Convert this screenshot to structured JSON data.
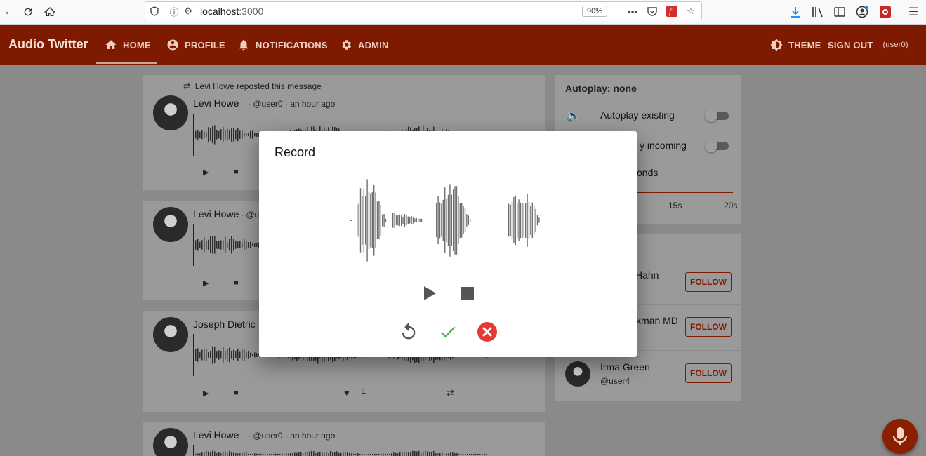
{
  "browser": {
    "url_host": "localhost",
    "url_port": ":3000",
    "zoom": "90%"
  },
  "appbar": {
    "brand": "Audio Twitter",
    "nav": [
      "HOME",
      "PROFILE",
      "NOTIFICATIONS",
      "ADMIN"
    ],
    "theme_label": "THEME",
    "signout_label": "SIGN OUT",
    "signout_user": "(user0)"
  },
  "feed": {
    "posts": [
      {
        "repost_text": "Levi Howe reposted this message",
        "name": "Levi Howe",
        "handle": "@user0",
        "time": "an hour ago"
      },
      {
        "name": "Levi Howe",
        "handle": "@u"
      },
      {
        "name": "Joseph Dietric",
        "likes": "1"
      },
      {
        "name": "Levi Howe",
        "handle": "@user0",
        "time": "an hour ago"
      }
    ]
  },
  "sidebar": {
    "autoplay_title": "Autoplay: none",
    "autoplay_existing": "Autoplay existing",
    "autoplay_incoming_partial": "y incoming",
    "seconds_partial": "onds",
    "tick_15": "15s",
    "tick_20": "20s",
    "follow_users": [
      {
        "name_partial": "Hahn",
        "follow": "FOLLOW"
      },
      {
        "name_partial": "kman MD",
        "follow": "FOLLOW"
      },
      {
        "name": "Irma Green",
        "handle": "@user4",
        "follow": "FOLLOW"
      }
    ]
  },
  "dialog": {
    "title": "Record"
  },
  "colors": {
    "appbar": "#7e1a00",
    "accept": "#4caf50",
    "cancel": "#e53935",
    "fab": "#8a2000"
  }
}
